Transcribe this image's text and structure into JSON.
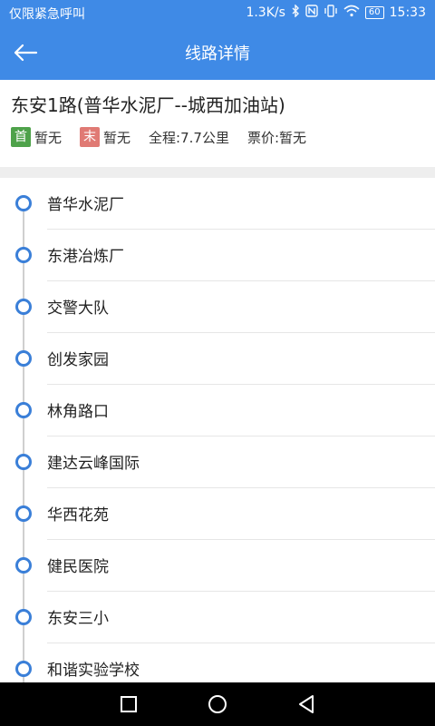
{
  "status_bar": {
    "left_text": "仅限紧急呼叫",
    "net_speed": "1.3K/s",
    "battery": "60",
    "time": "15:33",
    "icons": [
      "bluetooth-icon",
      "nfc-icon",
      "vibrate-icon",
      "wifi-icon",
      "battery-icon"
    ]
  },
  "app_bar": {
    "title": "线路详情",
    "back_icon": "arrow-left-icon"
  },
  "route": {
    "name": "东安1路(普华水泥厂--城西加油站)",
    "first_tag": "首",
    "first_value": "暂无",
    "last_tag": "末",
    "last_value": "暂无",
    "distance": "全程:7.7公里",
    "fare": "票价:暂无"
  },
  "stops": [
    {
      "name": "普华水泥厂"
    },
    {
      "name": "东港冶炼厂"
    },
    {
      "name": "交警大队"
    },
    {
      "name": "创发家园"
    },
    {
      "name": "林角路口"
    },
    {
      "name": "建达云峰国际"
    },
    {
      "name": "华西花苑"
    },
    {
      "name": "健民医院"
    },
    {
      "name": "东安三小"
    },
    {
      "name": "和谐实验学校"
    }
  ],
  "nav_bar": {
    "icons": [
      "recents-square-icon",
      "home-circle-icon",
      "back-triangle-icon"
    ]
  },
  "colors": {
    "primary": "#3f8ae6",
    "first_tag": "#4ea24a",
    "last_tag": "#e07a74",
    "stop_dot": "#3a7fd8"
  }
}
